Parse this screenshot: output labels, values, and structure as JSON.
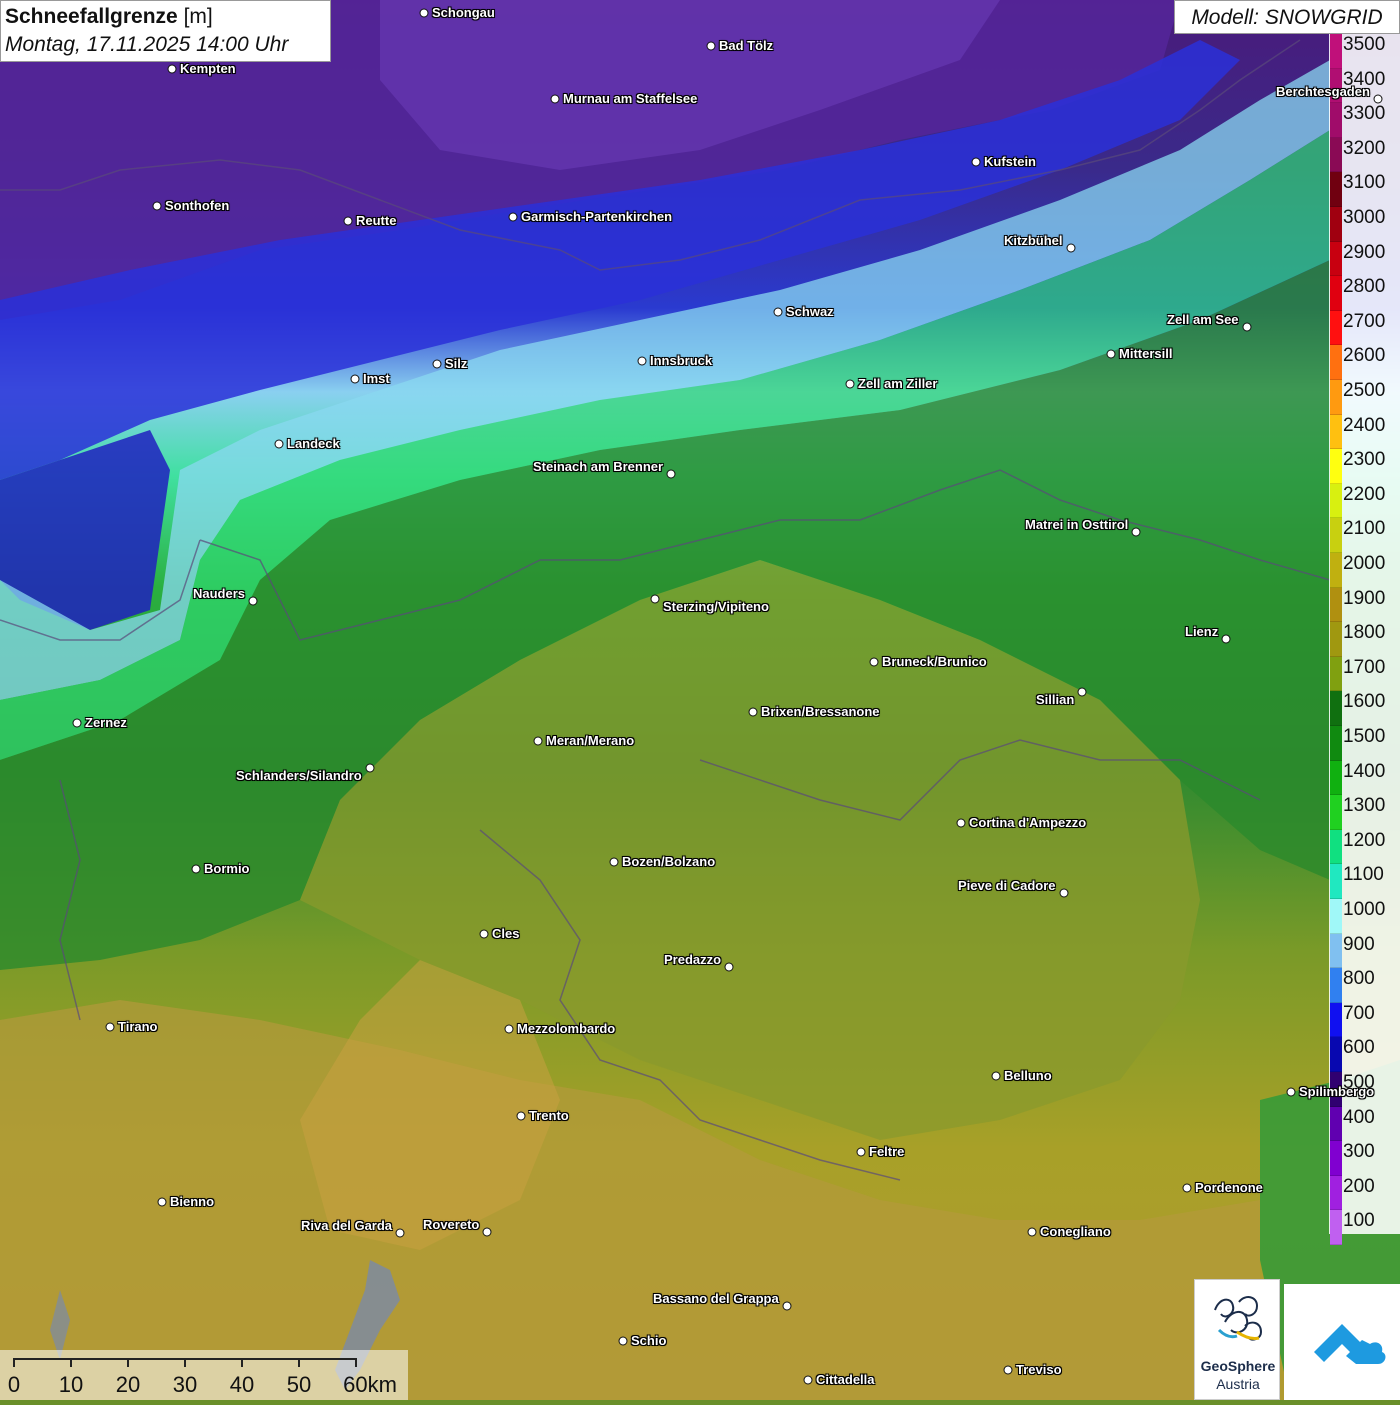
{
  "header": {
    "title_bold": "Schneefallgrenze",
    "title_unit": "[m]",
    "datetime": "Montag, 17.11.2025 14:00 Uhr",
    "model": "Modell: SNOWGRID"
  },
  "legend": {
    "levels": [
      {
        "label": "3500",
        "color": "#c0107a"
      },
      {
        "label": "3400",
        "color": "#b00e72"
      },
      {
        "label": "3300",
        "color": "#a00c6a"
      },
      {
        "label": "3200",
        "color": "#8a0a55"
      },
      {
        "label": "3100",
        "color": "#700010"
      },
      {
        "label": "3000",
        "color": "#a00010"
      },
      {
        "label": "2900",
        "color": "#c80010"
      },
      {
        "label": "2800",
        "color": "#e00010"
      },
      {
        "label": "2700",
        "color": "#ff1010"
      },
      {
        "label": "2600",
        "color": "#ff7010"
      },
      {
        "label": "2500",
        "color": "#ff9a10"
      },
      {
        "label": "2400",
        "color": "#ffc010"
      },
      {
        "label": "2300",
        "color": "#ffff10"
      },
      {
        "label": "2200",
        "color": "#d8f010"
      },
      {
        "label": "2100",
        "color": "#c8d010"
      },
      {
        "label": "2000",
        "color": "#c0b010"
      },
      {
        "label": "1900",
        "color": "#b09010"
      },
      {
        "label": "1800",
        "color": "#a09810"
      },
      {
        "label": "1700",
        "color": "#80a010"
      },
      {
        "label": "1600",
        "color": "#107010"
      },
      {
        "label": "1500",
        "color": "#108a10"
      },
      {
        "label": "1400",
        "color": "#10b010"
      },
      {
        "label": "1300",
        "color": "#20d020"
      },
      {
        "label": "1200",
        "color": "#10e080"
      },
      {
        "label": "1100",
        "color": "#20e8c0"
      },
      {
        "label": "1000",
        "color": "#a0f8f8"
      },
      {
        "label": "900",
        "color": "#80c0f0"
      },
      {
        "label": "800",
        "color": "#3080f0"
      },
      {
        "label": "700",
        "color": "#1010f0"
      },
      {
        "label": "600",
        "color": "#0808b0"
      },
      {
        "label": "500",
        "color": "#300070"
      },
      {
        "label": "400",
        "color": "#6000b0"
      },
      {
        "label": "300",
        "color": "#8000d0"
      },
      {
        "label": "200",
        "color": "#a020e0"
      },
      {
        "label": "100",
        "color": "#c060f0"
      }
    ]
  },
  "cities": [
    {
      "name": "Schongau"
    },
    {
      "name": "Bad Tölz"
    },
    {
      "name": "Kempten"
    },
    {
      "name": "Murnau am Staffelsee"
    },
    {
      "name": "Berchtesgaden"
    },
    {
      "name": "Kufstein"
    },
    {
      "name": "Sonthofen"
    },
    {
      "name": "Reutte"
    },
    {
      "name": "Garmisch-Partenkirchen"
    },
    {
      "name": "Kitzbühel"
    },
    {
      "name": "Schwaz"
    },
    {
      "name": "Zell am See"
    },
    {
      "name": "Mittersill"
    },
    {
      "name": "Innsbruck"
    },
    {
      "name": "Silz"
    },
    {
      "name": "Imst"
    },
    {
      "name": "Zell am Ziller"
    },
    {
      "name": "Landeck"
    },
    {
      "name": "Steinach am Brenner"
    },
    {
      "name": "Matrei in Osttirol"
    },
    {
      "name": "Nauders"
    },
    {
      "name": "Sterzing/Vipiteno"
    },
    {
      "name": "Lienz"
    },
    {
      "name": "Bruneck/Brunico"
    },
    {
      "name": "Sillian"
    },
    {
      "name": "Brixen/Bressanone"
    },
    {
      "name": "Zernez"
    },
    {
      "name": "Meran/Merano"
    },
    {
      "name": "Schlanders/Silandro"
    },
    {
      "name": "Cortina d'Ampezzo"
    },
    {
      "name": "Bozen/Bolzano"
    },
    {
      "name": "Bormio"
    },
    {
      "name": "Pieve di Cadore"
    },
    {
      "name": "Cles"
    },
    {
      "name": "Predazzo"
    },
    {
      "name": "Tirano"
    },
    {
      "name": "Mezzolombardo"
    },
    {
      "name": "Belluno"
    },
    {
      "name": "Spilimbergo"
    },
    {
      "name": "Trento"
    },
    {
      "name": "Feltre"
    },
    {
      "name": "Pordenone"
    },
    {
      "name": "Bienno"
    },
    {
      "name": "Riva del Garda"
    },
    {
      "name": "Rovereto"
    },
    {
      "name": "Conegliano"
    },
    {
      "name": "Bassano del Grappa"
    },
    {
      "name": "Schio"
    },
    {
      "name": "Treviso"
    },
    {
      "name": "Cittadella"
    }
  ],
  "scale": {
    "labels": [
      "0",
      "10",
      "20",
      "30",
      "40",
      "50",
      "60km"
    ]
  },
  "logos": {
    "geosphere_line1": "GeoSphere",
    "geosphere_line2": "Austria"
  }
}
